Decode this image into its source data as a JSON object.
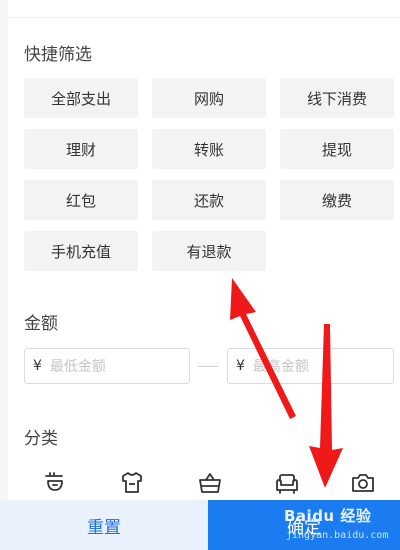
{
  "quick_filter": {
    "title": "快捷筛选",
    "chips": [
      "全部支出",
      "网购",
      "线下消费",
      "理财",
      "转账",
      "提现",
      "红包",
      "还款",
      "缴费",
      "手机充值",
      "有退款"
    ]
  },
  "amount": {
    "title": "金额",
    "currency": "¥",
    "min_placeholder": "最低金额",
    "max_placeholder": "最高金额"
  },
  "category": {
    "title": "分类",
    "icons": [
      "food-icon",
      "clothing-icon",
      "shopping-basket-icon",
      "sofa-icon",
      "camera-icon"
    ]
  },
  "footer": {
    "reset_label": "重置",
    "confirm_label": "确定"
  },
  "watermark": {
    "text": "Baidu 经验",
    "url": "jingyan.baidu.com"
  },
  "colors": {
    "accent": "#1a7cf0",
    "reset_bg": "#e8f1fc",
    "annotation_arrow": "#f01919"
  }
}
